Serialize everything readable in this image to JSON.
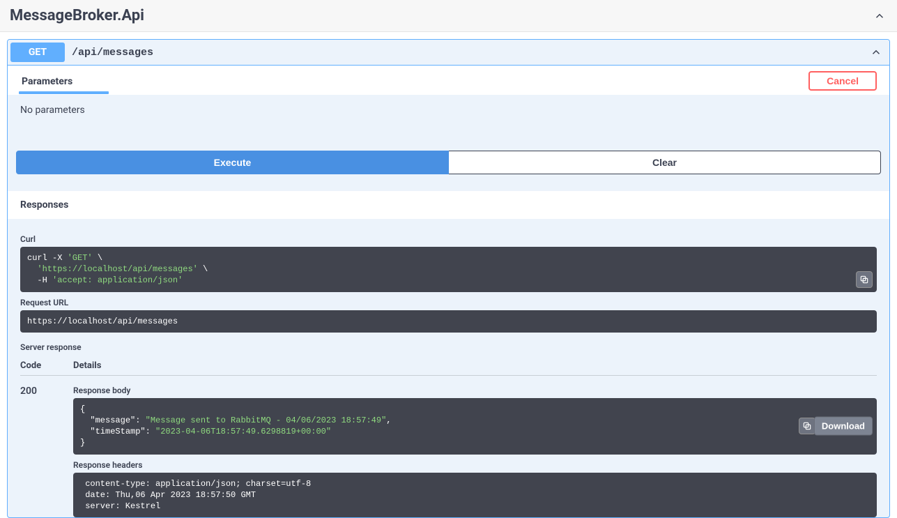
{
  "api": {
    "title": "MessageBroker.Api"
  },
  "operation": {
    "method": "GET",
    "path": "/api/messages"
  },
  "tabs": {
    "parameters": "Parameters",
    "cancel": "Cancel"
  },
  "params": {
    "none": "No parameters"
  },
  "actions": {
    "execute": "Execute",
    "clear": "Clear",
    "download": "Download"
  },
  "responses_label": "Responses",
  "curl": {
    "label": "Curl",
    "line1_a": "curl -X ",
    "line1_b": "'GET'",
    "line1_c": " \\",
    "line2_a": "  ",
    "line2_b": "'https://localhost/api/messages'",
    "line2_c": " \\",
    "line3_a": "  -H ",
    "line3_b": "'accept: application/json'"
  },
  "request_url": {
    "label": "Request URL",
    "value": "https://localhost/api/messages"
  },
  "server_response": {
    "label": "Server response",
    "code_header": "Code",
    "details_header": "Details",
    "code": "200"
  },
  "body": {
    "label": "Response body",
    "open": "{",
    "l1_key": "\"message\"",
    "l1_colon": ": ",
    "l1_val": "\"Message sent to RabbitMQ - 04/06/2023 18:57:49\"",
    "l1_end": ",",
    "l2_key": "\"timeStamp\"",
    "l2_colon": ": ",
    "l2_val": "\"2023-04-06T18:57:49.6298819+00:00\"",
    "close": "}"
  },
  "headers": {
    "label": "Response headers",
    "l1": " content-type: application/json; charset=utf-8 ",
    "l2": " date: Thu,06 Apr 2023 18:57:50 GMT ",
    "l3": " server: Kestrel "
  }
}
